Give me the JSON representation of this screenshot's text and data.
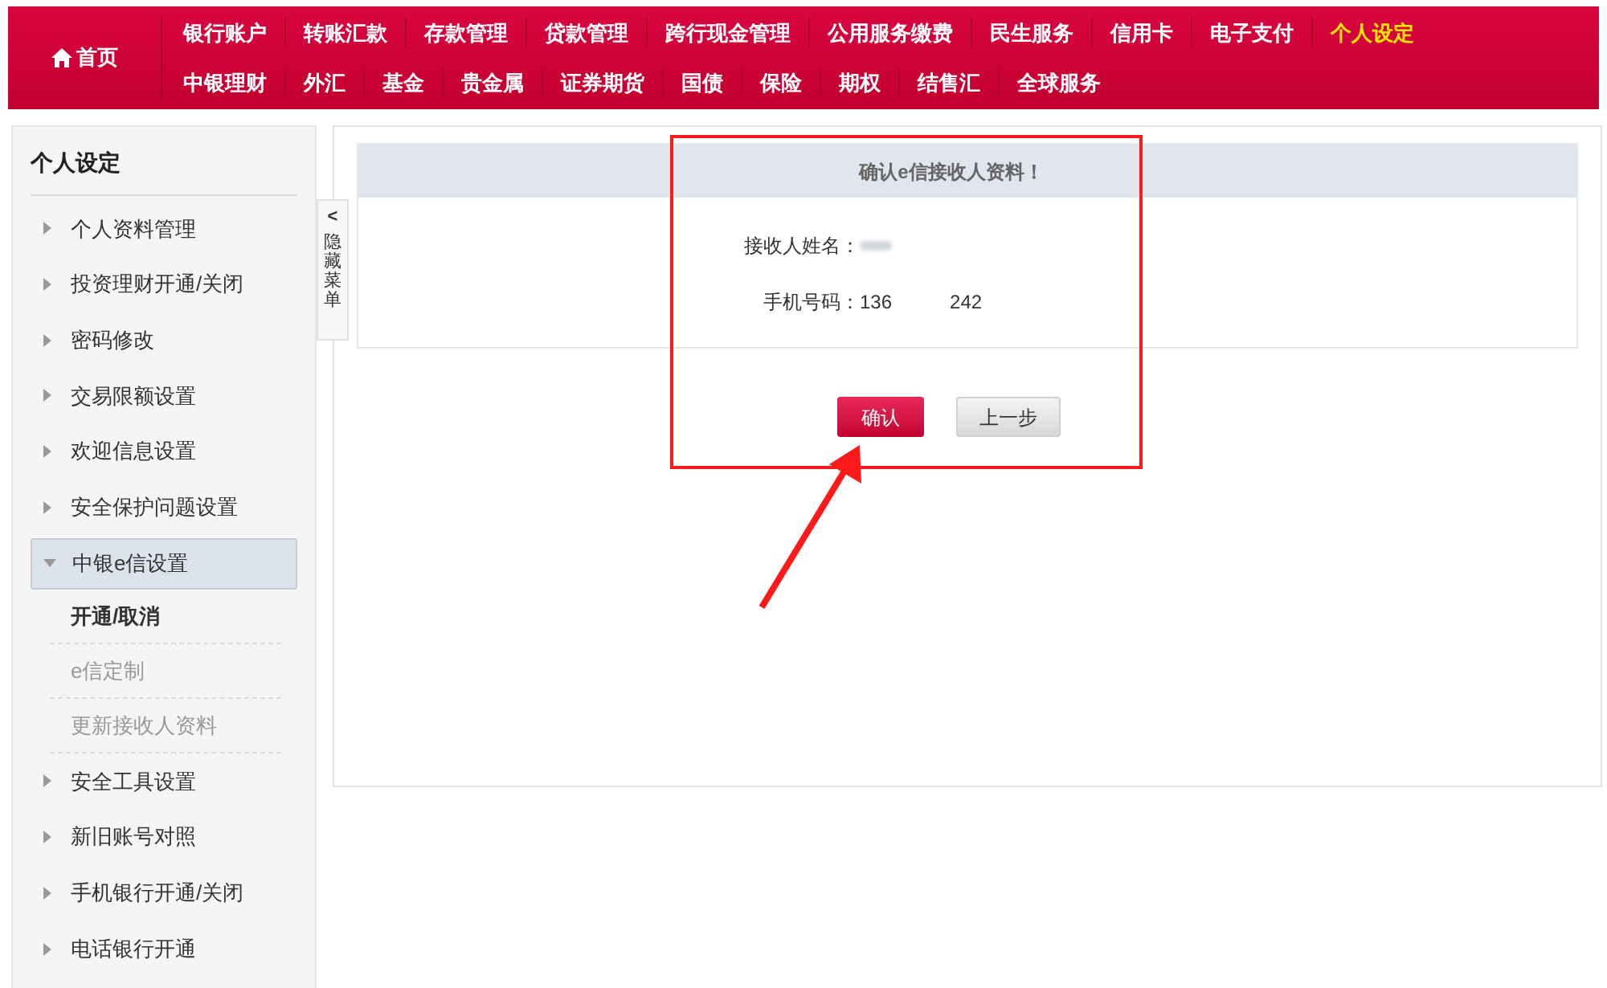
{
  "nav": {
    "home": "首页",
    "top_items": [
      {
        "label": "银行账户",
        "selected": false
      },
      {
        "label": "转账汇款",
        "selected": false
      },
      {
        "label": "存款管理",
        "selected": false
      },
      {
        "label": "贷款管理",
        "selected": false
      },
      {
        "label": "跨行现金管理",
        "selected": false
      },
      {
        "label": "公用服务缴费",
        "selected": false
      },
      {
        "label": "民生服务",
        "selected": false
      },
      {
        "label": "信用卡",
        "selected": false
      },
      {
        "label": "电子支付",
        "selected": false
      },
      {
        "label": "个人设定",
        "selected": true
      }
    ],
    "bottom_items": [
      {
        "label": "中银理财",
        "selected": false
      },
      {
        "label": "外汇",
        "selected": false
      },
      {
        "label": "基金",
        "selected": false
      },
      {
        "label": "贵金属",
        "selected": false
      },
      {
        "label": "证券期货",
        "selected": false
      },
      {
        "label": "国债",
        "selected": false
      },
      {
        "label": "保险",
        "selected": false
      },
      {
        "label": "期权",
        "selected": false
      },
      {
        "label": "结售汇",
        "selected": false
      },
      {
        "label": "全球服务",
        "selected": false
      }
    ]
  },
  "sidebar": {
    "title": "个人设定",
    "hide_tab": {
      "arrow": "<",
      "label": "隐藏菜单"
    },
    "items": [
      {
        "label": "个人资料管理",
        "expanded": false
      },
      {
        "label": "投资理财开通/关闭",
        "expanded": false
      },
      {
        "label": "密码修改",
        "expanded": false
      },
      {
        "label": "交易限额设置",
        "expanded": false
      },
      {
        "label": "欢迎信息设置",
        "expanded": false
      },
      {
        "label": "安全保护问题设置",
        "expanded": false
      },
      {
        "label": "中银e信设置",
        "expanded": true,
        "children": [
          {
            "label": "开通/取消",
            "selected": true
          },
          {
            "label": "e信定制",
            "selected": false
          },
          {
            "label": "更新接收人资料",
            "selected": false
          }
        ]
      },
      {
        "label": "安全工具设置",
        "expanded": false
      },
      {
        "label": "新旧账号对照",
        "expanded": false
      },
      {
        "label": "手机银行开通/关闭",
        "expanded": false
      },
      {
        "label": "电话银行开通",
        "expanded": false
      }
    ]
  },
  "confirm": {
    "title": "确认e信接收人资料！",
    "fields": [
      {
        "label": "接收人姓名：",
        "kind": "redacted"
      },
      {
        "label": "手机号码：",
        "kind": "partial",
        "value_start": "136",
        "value_end": "242"
      }
    ],
    "buttons": [
      {
        "label": "确认",
        "kind": "primary"
      },
      {
        "label": "上一步",
        "kind": "secondary"
      }
    ]
  }
}
